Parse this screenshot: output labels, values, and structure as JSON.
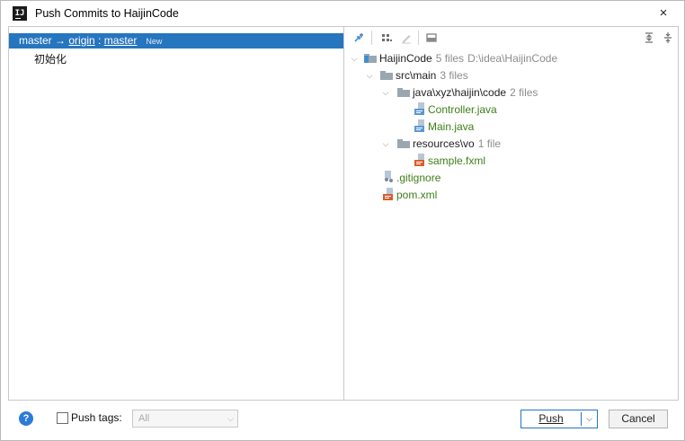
{
  "window": {
    "title": "Push Commits to HaijinCode",
    "app_icon_text": "IJ",
    "close_glyph": "×"
  },
  "push_row": {
    "local_branch": "master",
    "arrow": " → ",
    "remote": "origin",
    "separator": " : ",
    "remote_branch": "master",
    "badge": "New"
  },
  "commits": [
    {
      "message": "初始化"
    }
  ],
  "toolbar": {
    "icons": [
      "expand-diff-icon",
      "group-by-icon",
      "edit-source-icon",
      "show-diff-icon",
      "expand-all-icon",
      "collapse-all-icon"
    ]
  },
  "tree": {
    "root": {
      "name": "HaijinCode",
      "count": "5 files",
      "path": "D:\\idea\\HaijinCode"
    },
    "src_main": {
      "name": "src\\main",
      "count": "3 files"
    },
    "java_pkg": {
      "name": "java\\xyz\\haijin\\code",
      "count": "2 files"
    },
    "file_controller": {
      "name": "Controller.java"
    },
    "file_main": {
      "name": "Main.java"
    },
    "resources": {
      "name": "resources\\vo",
      "count": "1 file"
    },
    "file_sample": {
      "name": "sample.fxml"
    },
    "file_gitignore": {
      "name": ".gitignore"
    },
    "file_pom": {
      "name": "pom.xml"
    }
  },
  "bottom": {
    "help_glyph": "?",
    "push_tags_label": "Push tags:",
    "push_tags_mnemonic": "t",
    "tags_select_value": "All",
    "push_label": "Push",
    "cancel_label": "Cancel"
  },
  "colors": {
    "selection": "#2675bf",
    "added_file": "#3e7e1a",
    "folder": "#9aa7b0",
    "help": "#2d7bd8"
  }
}
